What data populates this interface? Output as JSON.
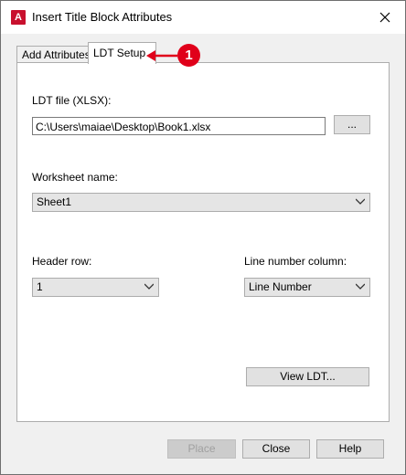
{
  "window": {
    "title": "Insert Title Block Attributes",
    "app_icon_letter": "A"
  },
  "tabs": [
    {
      "label": "Add Attributes"
    },
    {
      "label": "LDT Setup"
    }
  ],
  "callout": {
    "number": "1",
    "color": "#e0001a"
  },
  "ldt_file": {
    "label": "LDT file (XLSX):",
    "value": "C:\\Users\\maiae\\Desktop\\Book1.xlsx",
    "browse_label": "..."
  },
  "worksheet": {
    "label": "Worksheet name:",
    "value": "Sheet1"
  },
  "header_row": {
    "label": "Header row:",
    "value": "1"
  },
  "line_number": {
    "label": "Line number column:",
    "value": "Line Number"
  },
  "view_ldt_label": "View LDT...",
  "footer": {
    "place_label": "Place",
    "close_label": "Close",
    "help_label": "Help"
  }
}
